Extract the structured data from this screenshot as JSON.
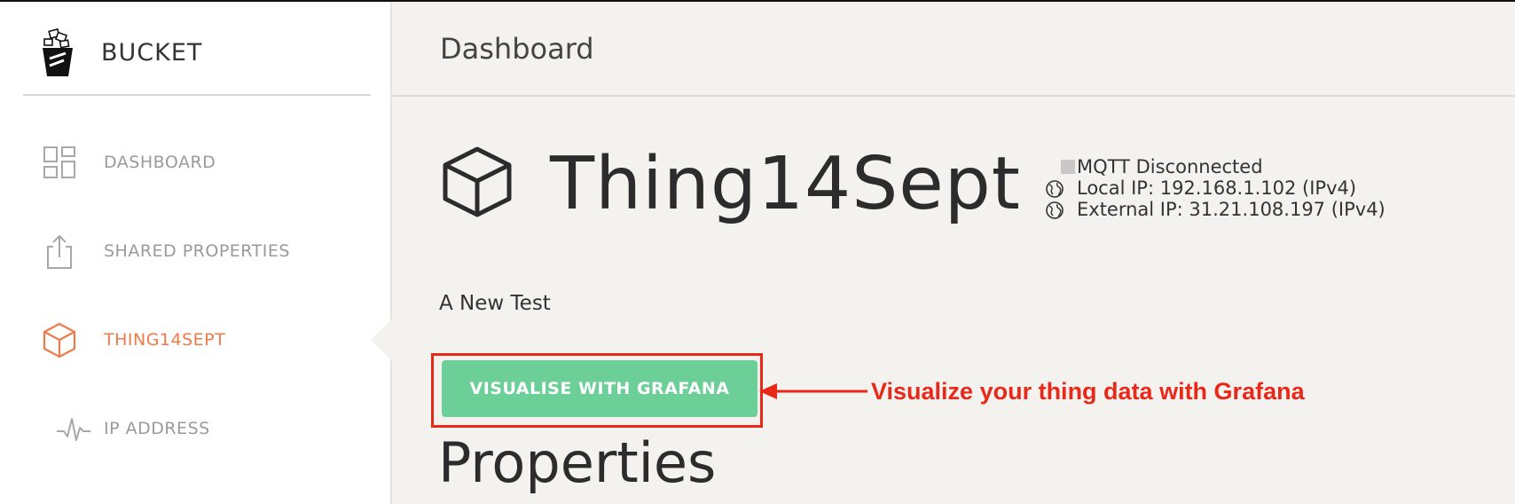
{
  "brand": {
    "title": "BUCKET"
  },
  "sidebar": {
    "items": [
      {
        "label": "DASHBOARD",
        "icon": "dashboard-grid-icon",
        "active": false
      },
      {
        "label": "SHARED PROPERTIES",
        "icon": "share-upload-icon",
        "active": false
      },
      {
        "label": "THING14SEPT",
        "icon": "cube-icon",
        "active": true
      },
      {
        "label": "IP ADDRESS",
        "icon": "pulse-icon",
        "active": false
      }
    ]
  },
  "header": {
    "title": "Dashboard"
  },
  "thing": {
    "name": "Thing14Sept",
    "description": "A New Test",
    "mqtt_status": "MQTT Disconnected",
    "local_ip": "Local IP: 192.168.1.102 (IPv4)",
    "external_ip": "External IP: 31.21.108.197 (IPv4)"
  },
  "actions": {
    "grafana_label": "VISUALISE WITH GRAFANA"
  },
  "annotation": {
    "text": "Visualize your thing data with Grafana"
  },
  "sections": {
    "properties_title": "Properties"
  },
  "colors": {
    "accent": "#ee7a4a",
    "button": "#6ccf97",
    "annotation": "#e8291a",
    "background": "#f3f2ef"
  }
}
